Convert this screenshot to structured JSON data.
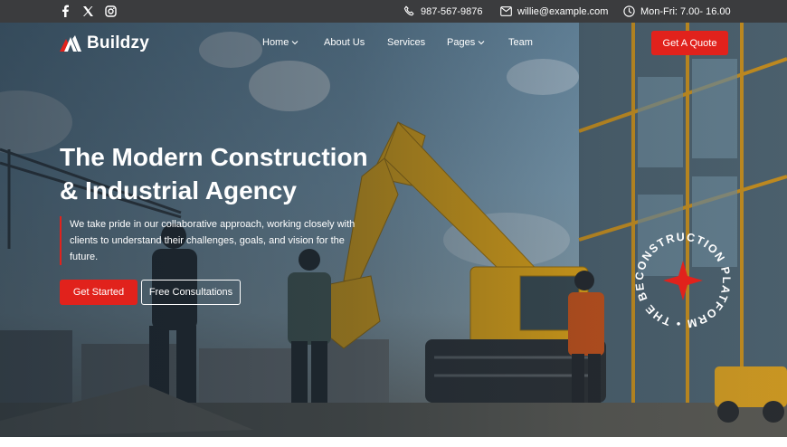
{
  "topbar": {
    "social": [
      {
        "icon": "facebook-icon"
      },
      {
        "icon": "x-twitter-icon"
      },
      {
        "icon": "instagram-icon"
      }
    ],
    "phone": "987-567-9876",
    "email": "willie@example.com",
    "hours": "Mon-Fri: 7.00- 16.00"
  },
  "nav": {
    "brand": "Buildzy",
    "items": [
      {
        "label": "Home",
        "dropdown": true
      },
      {
        "label": "About Us",
        "dropdown": false
      },
      {
        "label": "Services",
        "dropdown": false
      },
      {
        "label": "Pages",
        "dropdown": true
      },
      {
        "label": "Team",
        "dropdown": false
      }
    ],
    "cta": "Get A Quote"
  },
  "hero": {
    "title_line1": "The Modern Construction",
    "title_line2": "& Industrial Agency",
    "description": "We take pride in our collaborative approach, working closely with clients to understand their challenges, goals, and vision for the future.",
    "primary_button": "Get Started",
    "secondary_button": "Free Consultations",
    "badge_text": "CONSTRUCTION PLATFORM • THE BEST •"
  },
  "colors": {
    "accent": "#e1221c",
    "topbar": "#3b3c3e",
    "text": "#ffffff"
  }
}
